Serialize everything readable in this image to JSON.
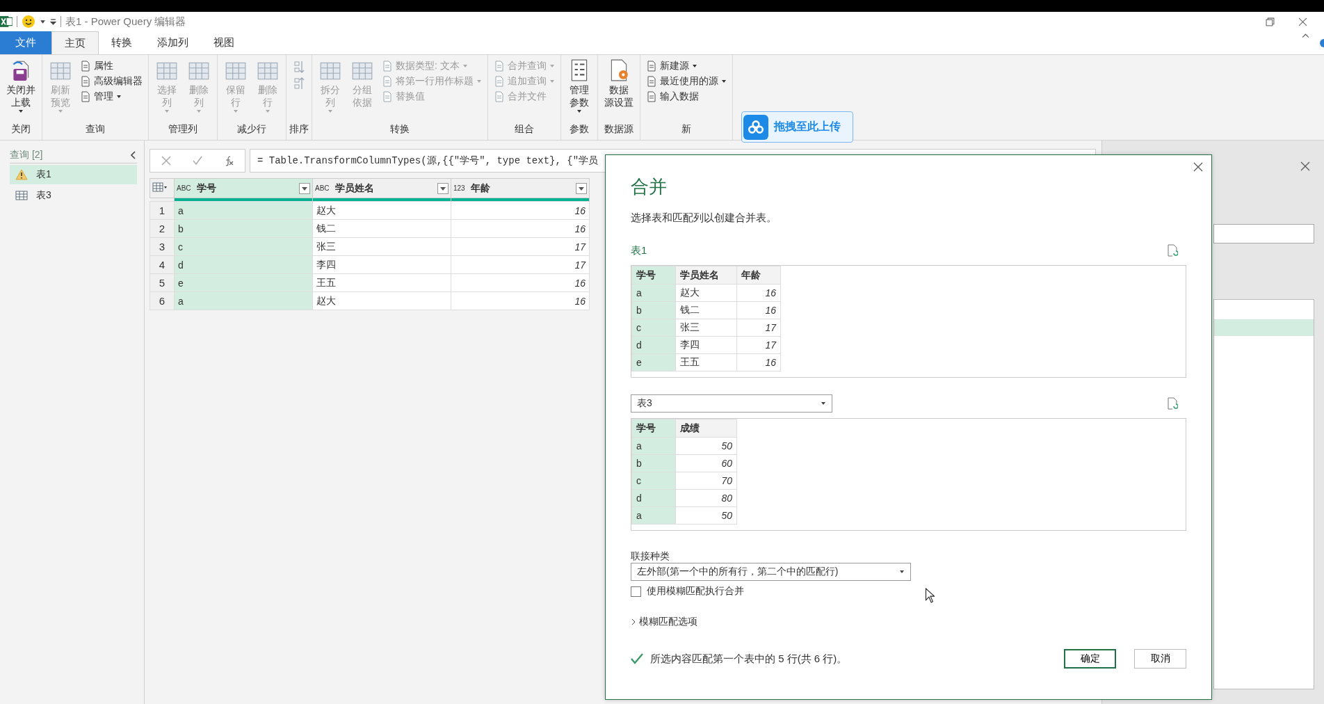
{
  "window": {
    "title": "表1 - Power Query 编辑器"
  },
  "tabs": [
    {
      "label": "文件",
      "kind": "file",
      "selected": false
    },
    {
      "label": "主页",
      "kind": "tab",
      "selected": true
    },
    {
      "label": "转换",
      "kind": "tab",
      "selected": false
    },
    {
      "label": "添加列",
      "kind": "tab",
      "selected": false
    },
    {
      "label": "视图",
      "kind": "tab",
      "selected": false
    }
  ],
  "ribbon": [
    {
      "label": "关闭",
      "items": [
        {
          "kind": "large",
          "label_lines": [
            "关闭并",
            "上载"
          ],
          "dropdown": true,
          "disabled": false
        }
      ]
    },
    {
      "label": "查询",
      "items": [
        {
          "kind": "large",
          "label_lines": [
            "刷新",
            "预览"
          ],
          "dropdown": true,
          "disabled": true
        },
        {
          "kind": "small",
          "label": "属性",
          "dropdown": false,
          "disabled": false
        },
        {
          "kind": "small",
          "label": "高级编辑器",
          "dropdown": false,
          "disabled": false
        },
        {
          "kind": "small",
          "label": "管理",
          "dropdown": true,
          "disabled": false
        }
      ]
    },
    {
      "label": "管理列",
      "items": [
        {
          "kind": "large",
          "label_lines": [
            "选择",
            "列"
          ],
          "dropdown": true,
          "disabled": true
        },
        {
          "kind": "large",
          "label_lines": [
            "删除",
            "列"
          ],
          "dropdown": true,
          "disabled": true
        }
      ]
    },
    {
      "label": "减少行",
      "items": [
        {
          "kind": "large",
          "label_lines": [
            "保留",
            "行"
          ],
          "dropdown": true,
          "disabled": true
        },
        {
          "kind": "large",
          "label_lines": [
            "删除",
            "行"
          ],
          "dropdown": true,
          "disabled": true
        }
      ]
    },
    {
      "label": "排序",
      "items": [
        {
          "kind": "icon",
          "disabled": true
        },
        {
          "kind": "icon",
          "disabled": true
        }
      ]
    },
    {
      "label": "转换",
      "items": [
        {
          "kind": "large",
          "label_lines": [
            "拆分",
            "列"
          ],
          "dropdown": true,
          "disabled": true
        },
        {
          "kind": "large",
          "label_lines": [
            "分组",
            "依据"
          ],
          "dropdown": false,
          "disabled": true
        },
        {
          "kind": "small",
          "label": "数据类型: 文本",
          "dropdown": true,
          "disabled": true
        },
        {
          "kind": "small",
          "label": "将第一行用作标题",
          "dropdown": true,
          "disabled": true
        },
        {
          "kind": "small",
          "label": "替换值",
          "dropdown": false,
          "disabled": true
        }
      ]
    },
    {
      "label": "组合",
      "items": [
        {
          "kind": "small",
          "label": "合并查询",
          "dropdown": true,
          "disabled": true
        },
        {
          "kind": "small",
          "label": "追加查询",
          "dropdown": true,
          "disabled": true
        },
        {
          "kind": "small",
          "label": "合并文件",
          "dropdown": false,
          "disabled": true
        }
      ]
    },
    {
      "label": "参数",
      "items": [
        {
          "kind": "large",
          "label_lines": [
            "管理",
            "参数"
          ],
          "dropdown": true,
          "disabled": false
        }
      ]
    },
    {
      "label": "数据源",
      "items": [
        {
          "kind": "large",
          "label_lines": [
            "数据",
            "源设置"
          ],
          "dropdown": false,
          "disabled": false
        }
      ]
    },
    {
      "label": "新",
      "items": [
        {
          "kind": "small",
          "label": "新建源",
          "dropdown": true,
          "disabled": false
        },
        {
          "kind": "small",
          "label": "最近使用的源",
          "dropdown": true,
          "disabled": false
        },
        {
          "kind": "small",
          "label": "输入数据",
          "dropdown": false,
          "disabled": false
        }
      ]
    }
  ],
  "upload_badge": {
    "label": "拖拽至此上传"
  },
  "queries": {
    "header": "查询 [2]",
    "items": [
      {
        "label": "表1",
        "kind": "warning",
        "selected": true
      },
      {
        "label": "表3",
        "kind": "table",
        "selected": false
      }
    ]
  },
  "formula": "= Table.TransformColumnTypes(源,{{\"学号\", type text}, {\"学员",
  "grid": {
    "columns": [
      {
        "label": "学号",
        "type_label": "ABC",
        "selected": true
      },
      {
        "label": "学员姓名",
        "type_label": "ABC",
        "selected": false
      },
      {
        "label": "年龄",
        "type_label": "123",
        "selected": false
      }
    ],
    "rows": [
      {
        "num": "1",
        "cells": [
          "a",
          "赵大",
          "16"
        ]
      },
      {
        "num": "2",
        "cells": [
          "b",
          "钱二",
          "16"
        ]
      },
      {
        "num": "3",
        "cells": [
          "c",
          "张三",
          "17"
        ]
      },
      {
        "num": "4",
        "cells": [
          "d",
          "李四",
          "17"
        ]
      },
      {
        "num": "5",
        "cells": [
          "e",
          "王五",
          "16"
        ]
      },
      {
        "num": "6",
        "cells": [
          "a",
          "赵大",
          "16"
        ]
      }
    ]
  },
  "dialog": {
    "title": "合并",
    "description": "选择表和匹配列以创建合并表。",
    "first_table": "表1",
    "preview1": {
      "columns": [
        {
          "label": "学号",
          "selected": true
        },
        {
          "label": "学员姓名",
          "selected": false
        },
        {
          "label": "年龄",
          "selected": false
        }
      ],
      "rows": [
        [
          "a",
          "赵大",
          "16"
        ],
        [
          "b",
          "钱二",
          "16"
        ],
        [
          "c",
          "张三",
          "17"
        ],
        [
          "d",
          "李四",
          "17"
        ],
        [
          "e",
          "王五",
          "16"
        ]
      ]
    },
    "second_table": "表3",
    "preview2": {
      "columns": [
        {
          "label": "学号",
          "selected": true
        },
        {
          "label": "成绩",
          "selected": false
        }
      ],
      "rows": [
        [
          "a",
          "50"
        ],
        [
          "b",
          "60"
        ],
        [
          "c",
          "70"
        ],
        [
          "d",
          "80"
        ],
        [
          "a",
          "50"
        ]
      ]
    },
    "join_label": "联接种类",
    "join_value": "左外部(第一个中的所有行，第二个中的匹配行)",
    "fuzzy": {
      "label": "使用模糊匹配执行合并",
      "checked": false
    },
    "fuzzy_options": {
      "label": "模糊匹配选项",
      "expanded": false
    },
    "status": "所选内容匹配第一个表中的 5 行(共 6 行)。",
    "buttons": [
      {
        "label": "确定",
        "kind": "primary"
      },
      {
        "label": "取消",
        "kind": "secondary"
      }
    ]
  }
}
